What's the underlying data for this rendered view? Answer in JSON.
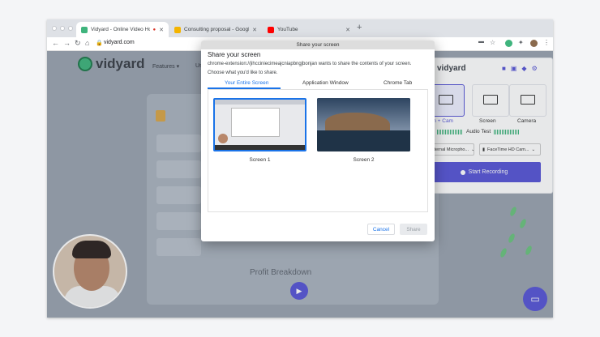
{
  "browser": {
    "tabs": [
      {
        "title": "Vidyard - Online Video Ho",
        "active": true,
        "favicon_color": "#3fb47d"
      },
      {
        "title": "Consulting proposal - Googl",
        "active": false,
        "favicon_color": "#f4b400"
      },
      {
        "title": "YouTube",
        "active": false,
        "favicon_color": "#ff0000"
      }
    ],
    "url": "vidyard.com"
  },
  "site": {
    "logo": "vidyard",
    "nav_features": "Features ▾",
    "nav_us": "Us",
    "profit_text": "Profit Breakdown"
  },
  "vidyard_panel": {
    "logo": "vidyard",
    "options": [
      {
        "label": "een + Cam",
        "selected": true
      },
      {
        "label": "Screen",
        "selected": false
      },
      {
        "label": "Camera",
        "selected": false
      }
    ],
    "audio_test": "Audio Test",
    "mic_select": "Internal Micropho...",
    "cam_select": "FaceTime HD Cam...",
    "record_button": "Start Recording",
    "accent_color": "#5856d6"
  },
  "dialog": {
    "bar_title": "Share your screen",
    "heading": "Share your screen",
    "message_line1": "chrome-extension://jihcciniecimeajcniapbngjbonjan wants to share the contents of your screen.",
    "message_line2": "Choose what you'd like to share.",
    "tabs": [
      "Your Entire Screen",
      "Application Window",
      "Chrome Tab"
    ],
    "screens": [
      "Screen 1",
      "Screen 2"
    ],
    "cancel": "Cancel",
    "share": "Share"
  }
}
